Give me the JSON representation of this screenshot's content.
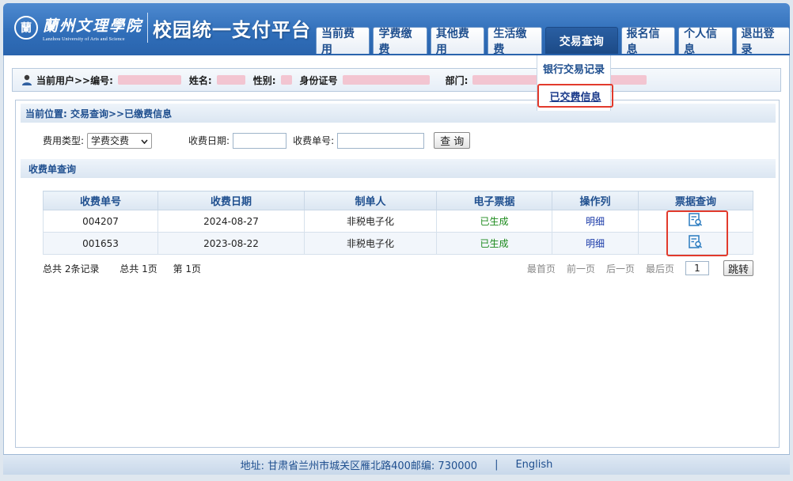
{
  "header": {
    "seal_char": "蘭",
    "school_cn": "蘭州文理學院",
    "school_en": "Lanzhou University of Arts and Science",
    "platform_title": "校园统一支付平台"
  },
  "nav": [
    {
      "label": "当前费用"
    },
    {
      "label": "学费缴费"
    },
    {
      "label": "其他费用"
    },
    {
      "label": "生活缴费"
    },
    {
      "label": "交易查询",
      "active": true
    },
    {
      "label": "报名信息"
    },
    {
      "label": "个人信息"
    },
    {
      "label": "退出登录"
    }
  ],
  "dropdown": {
    "item1": "银行交易记录",
    "item2": "已交费信息"
  },
  "userbar": {
    "current_user": "当前用户>>编号:",
    "name": "姓名:",
    "gender": "性别:",
    "id_card": "身份证号",
    "dept": "部门:"
  },
  "breadcrumb": "当前位置: 交易查询>>已缴费信息",
  "filter": {
    "fee_type_label": "费用类型:",
    "fee_type_value": "学费交费",
    "date_label": "收费日期:",
    "receipt_label": "收费单号:",
    "query_button": "查 询"
  },
  "section_title": "收费单查询",
  "table": {
    "headers": [
      "收费单号",
      "收费日期",
      "制单人",
      "电子票据",
      "操作列",
      "票据查询"
    ],
    "rows": [
      {
        "no": "004207",
        "date": "2024-08-27",
        "maker": "非税电子化",
        "ticket": "已生成",
        "action": "明细"
      },
      {
        "no": "001653",
        "date": "2023-08-22",
        "maker": "非税电子化",
        "ticket": "已生成",
        "action": "明细"
      }
    ]
  },
  "pager": {
    "total_records": "总共 2条记录",
    "total_pages": "总共 1页",
    "current_page": "第 1页",
    "first": "最首页",
    "prev": "前一页",
    "next": "后一页",
    "last": "最后页",
    "page_input": "1",
    "jump": "跳转"
  },
  "footer": {
    "address": "地址: 甘肃省兰州市城关区雁北路400邮编: 730000",
    "divider": "|",
    "english": "English"
  },
  "colors": {
    "header_blue": "#2f6db8",
    "highlight_red": "#e23a2c",
    "generated_green": "#1c8a1c"
  }
}
